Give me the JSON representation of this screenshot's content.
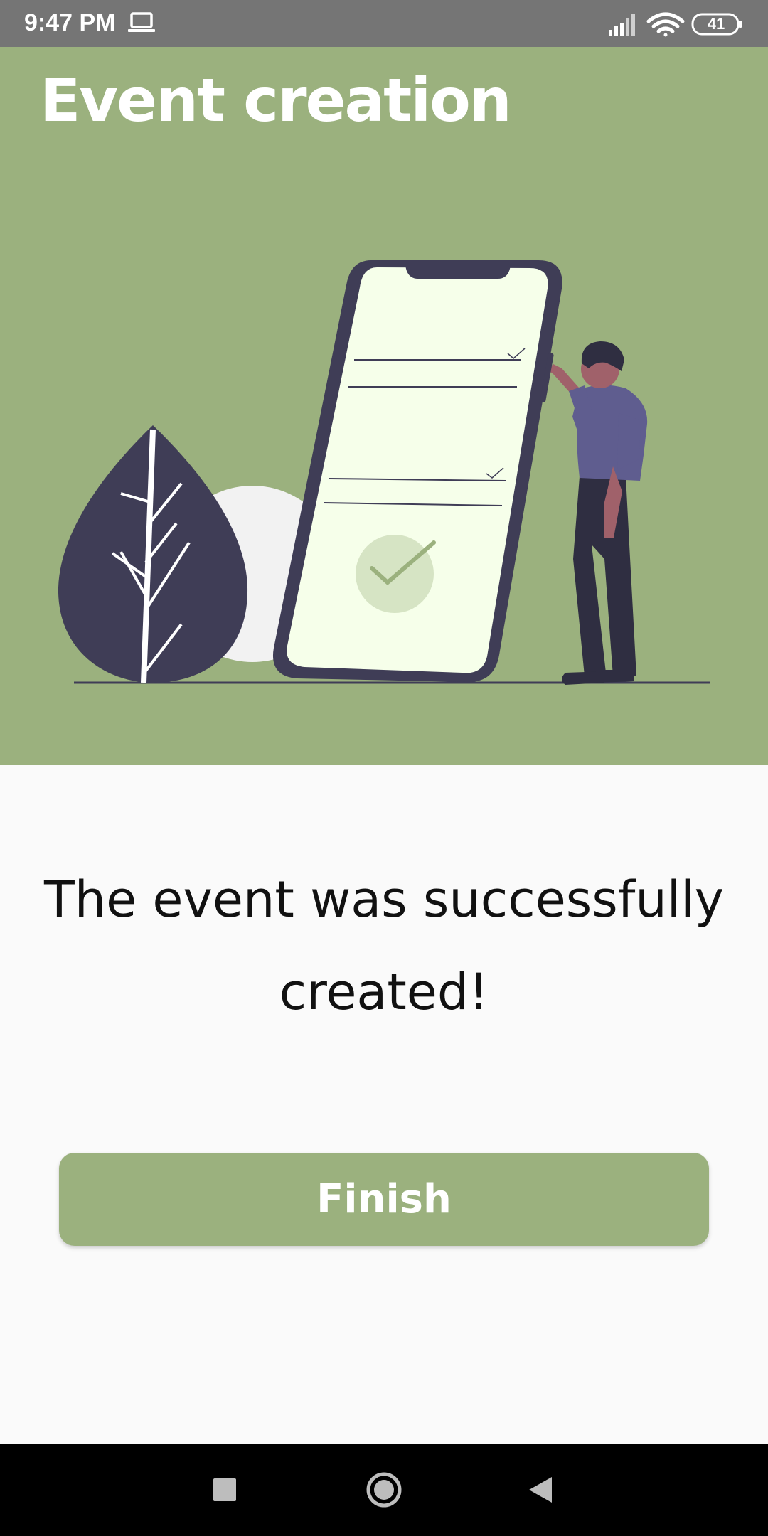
{
  "status_bar": {
    "time": "9:47 PM",
    "battery_level": "41",
    "icons": [
      "laptop-icon",
      "signal-icon",
      "wifi-icon",
      "battery-icon"
    ]
  },
  "header": {
    "title": "Event creation",
    "illustration": "phone-checklist-illustration",
    "background_color": "#9bb17e"
  },
  "main": {
    "message": "The event was successfully created!",
    "finish_label": "Finish",
    "button_color": "#9bb17e"
  },
  "nav_bar": {
    "icons": [
      "recents-icon",
      "home-icon",
      "back-icon"
    ]
  }
}
